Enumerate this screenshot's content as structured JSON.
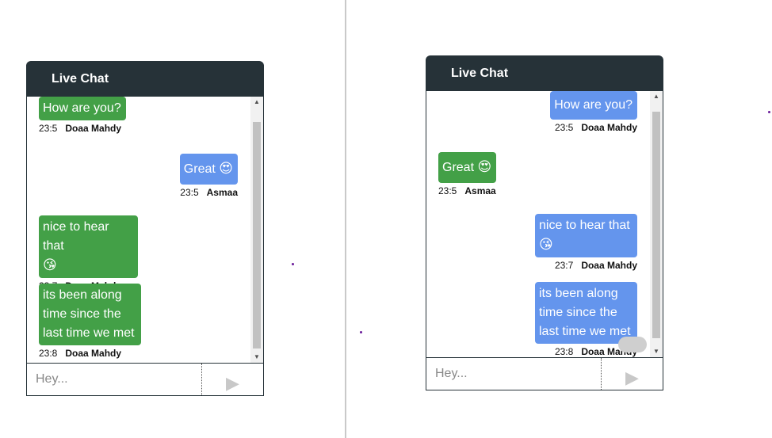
{
  "left_chat": {
    "title": "Live Chat",
    "input_placeholder": "Hey...",
    "send_icon": "send-icon",
    "messages": [
      {
        "text": "How are you?",
        "emoji": "",
        "time": "23:5",
        "sender": "Doaa Mahdy",
        "color": "#43a047"
      },
      {
        "text": "Great",
        "emoji": "😍",
        "time": "23:5",
        "sender": "Asmaa",
        "color": "#6495ed"
      },
      {
        "text": "nice to hear that",
        "emoji": "😘",
        "time": "23:7",
        "sender": "Doaa Mahdy",
        "color": "#43a047"
      },
      {
        "text": "its been along time since the last time we met",
        "emoji": "",
        "time": "23:8",
        "sender": "Doaa Mahdy",
        "color": "#43a047"
      }
    ]
  },
  "right_chat": {
    "title": "Live Chat",
    "input_placeholder": "Hey...",
    "send_icon": "send-icon",
    "messages": [
      {
        "text": "How are you?",
        "emoji": "",
        "time": "23:5",
        "sender": "Doaa Mahdy",
        "color": "#6495ed"
      },
      {
        "text": "Great",
        "emoji": "😍",
        "time": "23:5",
        "sender": "Asmaa",
        "color": "#43a047"
      },
      {
        "text": "nice to hear that",
        "emoji": "😘",
        "time": "23:7",
        "sender": "Doaa Mahdy",
        "color": "#6495ed"
      },
      {
        "text": "its been along time since the last time we met",
        "emoji": "",
        "time": "23:8",
        "sender": "Doaa Mahdy",
        "color": "#6495ed"
      }
    ]
  },
  "colors": {
    "header": "#263238",
    "self_bubble": "#43a047",
    "other_bubble": "#6495ed"
  }
}
